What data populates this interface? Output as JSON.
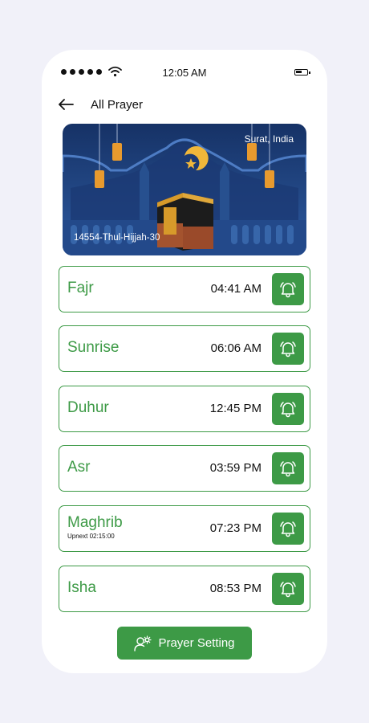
{
  "status_bar": {
    "time": "12:05 AM",
    "signal_icon": "signal-dots-icon",
    "wifi_icon": "wifi-icon",
    "battery_icon": "battery-icon"
  },
  "header": {
    "back_icon": "arrow-left-icon",
    "title": "All Prayer"
  },
  "banner": {
    "location": "Surat, India",
    "hijri_date": "14554-Thul-Hijjah-30"
  },
  "prayers": [
    {
      "name": "Fajr",
      "time": "04:41 AM",
      "note": ""
    },
    {
      "name": "Sunrise",
      "time": "06:06 AM",
      "note": ""
    },
    {
      "name": "Duhur",
      "time": "12:45 PM",
      "note": ""
    },
    {
      "name": "Asr",
      "time": "03:59 PM",
      "note": ""
    },
    {
      "name": "Maghrib",
      "time": "07:23 PM",
      "note": "Upnext 02:15:00"
    },
    {
      "name": "Isha",
      "time": "08:53 PM",
      "note": ""
    }
  ],
  "footer": {
    "button_label": "Prayer Setting",
    "button_icon": "person-gear-icon"
  },
  "colors": {
    "accent": "#3d9a46",
    "background": "#f1f1f9",
    "banner_bg": "#1f3e7a"
  }
}
